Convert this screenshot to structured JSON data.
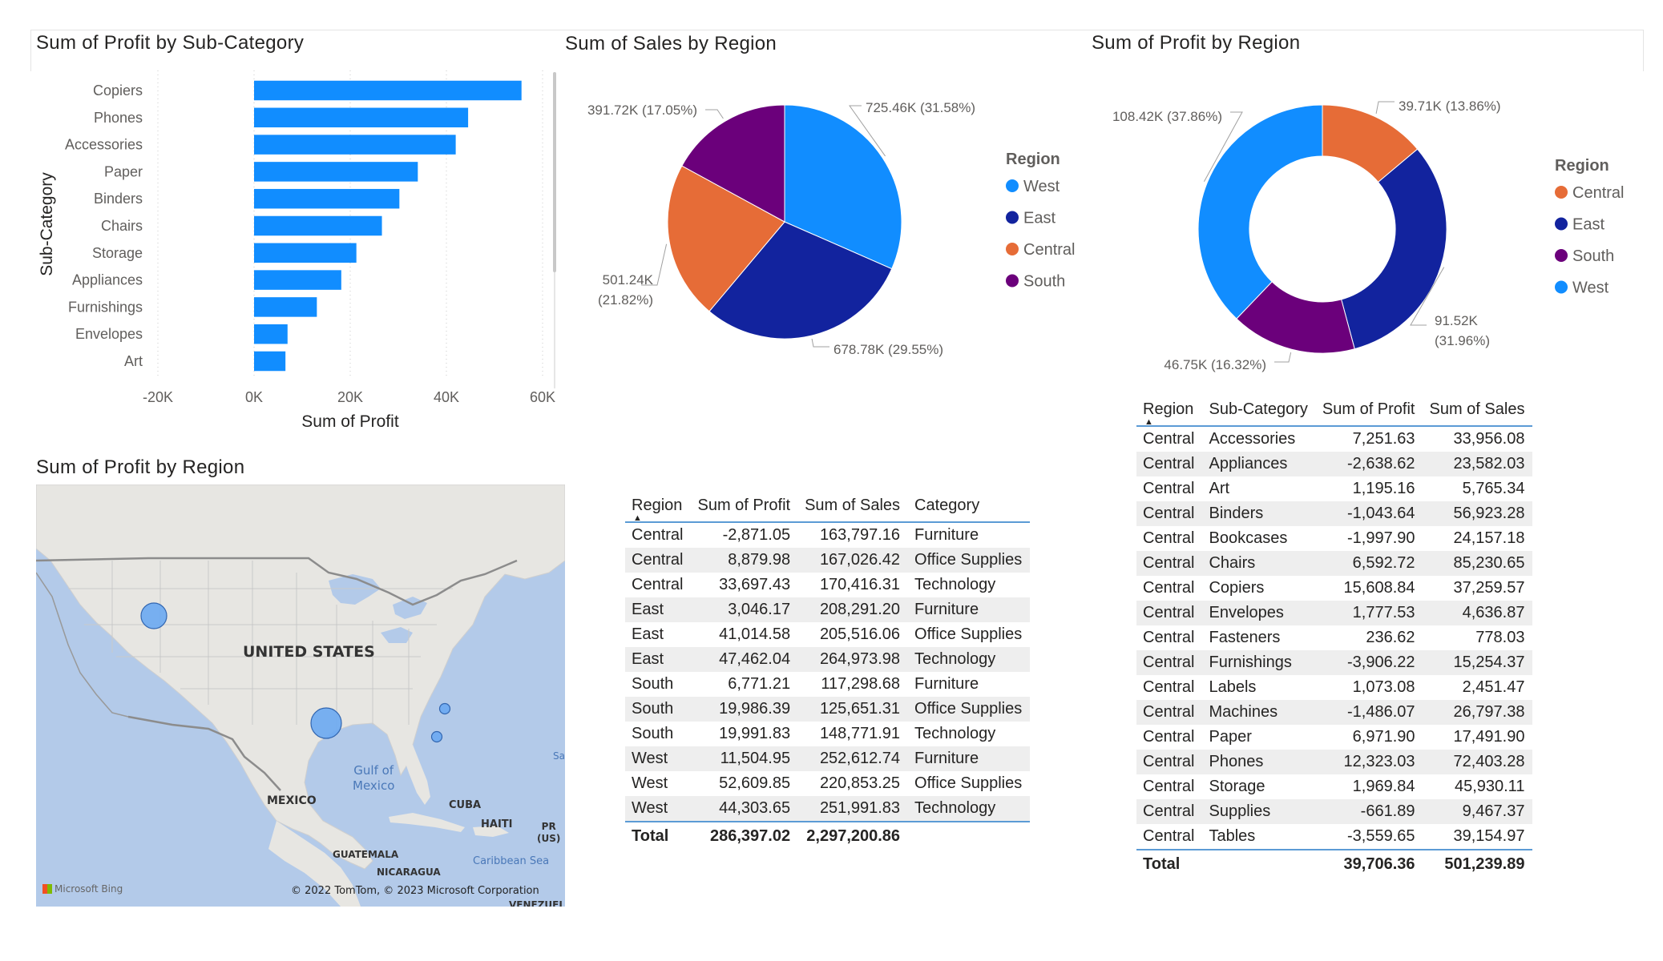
{
  "titles": {
    "bar": "Sum of Profit by Sub-Category",
    "pie": "Sum of Sales by Region",
    "donut": "Sum of Profit by Region",
    "map": "Sum of Profit by Region"
  },
  "colors": {
    "bar": "#118dff",
    "West": "#118dff",
    "East": "#12239e",
    "Central": "#e66c37",
    "South": "#6b007b"
  },
  "chart_data": [
    {
      "type": "bar",
      "orientation": "horizontal",
      "title": "Sum of Profit by Sub-Category",
      "xlabel": "Sum of Profit",
      "ylabel": "Sub-Category",
      "xlim": [
        -20000,
        60000
      ],
      "xticks": [
        "-20K",
        "0K",
        "20K",
        "40K",
        "60K"
      ],
      "xtick_values": [
        -20000,
        0,
        20000,
        40000,
        60000
      ],
      "categories": [
        "Copiers",
        "Phones",
        "Accessories",
        "Paper",
        "Binders",
        "Chairs",
        "Storage",
        "Appliances",
        "Furnishings",
        "Envelopes",
        "Art"
      ],
      "values": [
        55618,
        44516,
        41937,
        34054,
        30222,
        26590,
        21279,
        18138,
        13059,
        6964,
        6528
      ],
      "grid": true
    },
    {
      "type": "pie",
      "title": "Sum of Sales by Region",
      "legend_title": "Region",
      "legend_position": "right",
      "legend": [
        "West",
        "East",
        "Central",
        "South"
      ],
      "slices": [
        {
          "name": "West",
          "value": 725.46,
          "label": "725.46K (31.58%)"
        },
        {
          "name": "East",
          "value": 678.78,
          "label": "678.78K (29.55%)"
        },
        {
          "name": "Central",
          "value": 501.24,
          "label_lines": [
            "501.24K",
            "(21.82%)"
          ]
        },
        {
          "name": "South",
          "value": 391.72,
          "label": "391.72K (17.05%)"
        }
      ]
    },
    {
      "type": "donut",
      "title": "Sum of Profit by Region",
      "legend_title": "Region",
      "legend_position": "right",
      "legend": [
        "Central",
        "East",
        "South",
        "West"
      ],
      "slices": [
        {
          "name": "Central",
          "value": 39.71,
          "label": "39.71K (13.86%)"
        },
        {
          "name": "East",
          "value": 91.52,
          "label_lines": [
            "91.52K",
            "(31.96%)"
          ]
        },
        {
          "name": "South",
          "value": 46.75,
          "label": "46.75K (16.32%)"
        },
        {
          "name": "West",
          "value": 108.42,
          "label": "108.42K (37.86%)"
        }
      ]
    },
    {
      "type": "table",
      "title": "",
      "columns": [
        "Region",
        "Sum of Profit",
        "Sum of Sales",
        "Category"
      ],
      "rows": [
        [
          "Central",
          "-2,871.05",
          "163,797.16",
          "Furniture"
        ],
        [
          "Central",
          "8,879.98",
          "167,026.42",
          "Office Supplies"
        ],
        [
          "Central",
          "33,697.43",
          "170,416.31",
          "Technology"
        ],
        [
          "East",
          "3,046.17",
          "208,291.20",
          "Furniture"
        ],
        [
          "East",
          "41,014.58",
          "205,516.06",
          "Office Supplies"
        ],
        [
          "East",
          "47,462.04",
          "264,973.98",
          "Technology"
        ],
        [
          "South",
          "6,771.21",
          "117,298.68",
          "Furniture"
        ],
        [
          "South",
          "19,986.39",
          "125,651.31",
          "Office Supplies"
        ],
        [
          "South",
          "19,991.83",
          "148,771.91",
          "Technology"
        ],
        [
          "West",
          "11,504.95",
          "252,612.74",
          "Furniture"
        ],
        [
          "West",
          "52,609.85",
          "220,853.25",
          "Office Supplies"
        ],
        [
          "West",
          "44,303.65",
          "251,991.83",
          "Technology"
        ]
      ],
      "total": [
        "Total",
        "286,397.02",
        "2,297,200.86",
        ""
      ]
    },
    {
      "type": "table",
      "title": "",
      "columns": [
        "Region",
        "Sub-Category",
        "Sum of Profit",
        "Sum of Sales"
      ],
      "rows": [
        [
          "Central",
          "Accessories",
          "7,251.63",
          "33,956.08"
        ],
        [
          "Central",
          "Appliances",
          "-2,638.62",
          "23,582.03"
        ],
        [
          "Central",
          "Art",
          "1,195.16",
          "5,765.34"
        ],
        [
          "Central",
          "Binders",
          "-1,043.64",
          "56,923.28"
        ],
        [
          "Central",
          "Bookcases",
          "-1,997.90",
          "24,157.18"
        ],
        [
          "Central",
          "Chairs",
          "6,592.72",
          "85,230.65"
        ],
        [
          "Central",
          "Copiers",
          "15,608.84",
          "37,259.57"
        ],
        [
          "Central",
          "Envelopes",
          "1,777.53",
          "4,636.87"
        ],
        [
          "Central",
          "Fasteners",
          "236.62",
          "778.03"
        ],
        [
          "Central",
          "Furnishings",
          "-3,906.22",
          "15,254.37"
        ],
        [
          "Central",
          "Labels",
          "1,073.08",
          "2,451.47"
        ],
        [
          "Central",
          "Machines",
          "-1,486.07",
          "26,797.38"
        ],
        [
          "Central",
          "Paper",
          "6,971.90",
          "17,491.90"
        ],
        [
          "Central",
          "Phones",
          "12,323.03",
          "72,403.28"
        ],
        [
          "Central",
          "Storage",
          "1,969.84",
          "45,930.11"
        ],
        [
          "Central",
          "Supplies",
          "-661.89",
          "9,467.37"
        ],
        [
          "Central",
          "Tables",
          "-3,559.65",
          "39,154.97"
        ]
      ],
      "total": [
        "Total",
        "",
        "39,706.36",
        "501,239.89"
      ]
    }
  ],
  "map": {
    "title": "Sum of Profit by Region",
    "labels": {
      "country": "UNITED STATES",
      "gulf": [
        "Gulf of",
        "Mexico"
      ],
      "mexico": "MEXICO",
      "cuba": "CUBA",
      "haiti": "HAITI",
      "pr": [
        "PR",
        "(US)"
      ],
      "guatemala": "GUATEMALA",
      "nicaragua": "NICARAGUA",
      "caribbean": "Caribbean Sea",
      "venezuela": "VENEZUEL",
      "sar": "Sar",
      "brand": "Microsoft Bing",
      "copyright": "© 2022 TomTom, © 2023 Microsoft Corporation"
    },
    "bubbles": [
      {
        "region": "West",
        "profit": 108418.45
      },
      {
        "region": "Central",
        "profit": 39706.36
      },
      {
        "region": "South",
        "profit": 46749.43
      },
      {
        "region": "East",
        "profit": 91522.78
      }
    ]
  }
}
